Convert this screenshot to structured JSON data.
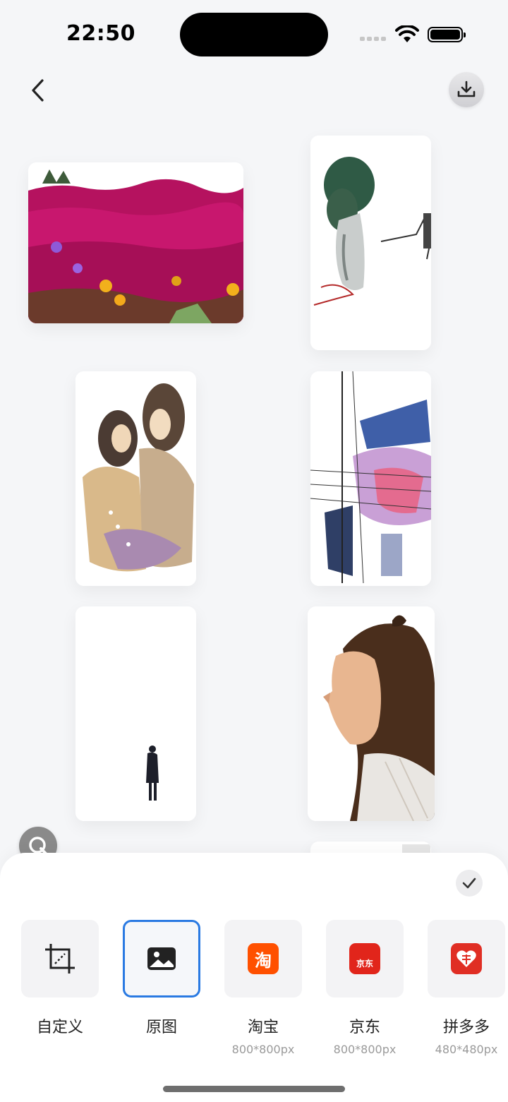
{
  "status_bar": {
    "time": "22:50"
  },
  "gallery": {
    "images": [
      {
        "name": "magenta flower field"
      },
      {
        "name": "ink painting tree"
      },
      {
        "name": "two figures watercolor"
      },
      {
        "name": "power lines watercolor"
      },
      {
        "name": "lone figure silhouette"
      },
      {
        "name": "woman portrait"
      }
    ]
  },
  "size_options": [
    {
      "label": "自定义",
      "icon": "crop-icon",
      "selected": false
    },
    {
      "label": "原图",
      "icon": "image-icon",
      "selected": true
    },
    {
      "label": "淘宝",
      "sub": "800*800px",
      "icon": "taobao-logo",
      "brand_glyph": "淘",
      "brand_color": "#ff5000"
    },
    {
      "label": "京东",
      "sub": "800*800px",
      "icon": "jd-logo",
      "brand_glyph": "京东",
      "brand_color": "#e1251b"
    },
    {
      "label": "拼多多",
      "sub": "480*480px",
      "icon": "pinduoduo-logo",
      "brand_color": "#e02e24"
    }
  ],
  "colors": {
    "accent": "#2a7ae2",
    "background": "#f5f6f8"
  }
}
